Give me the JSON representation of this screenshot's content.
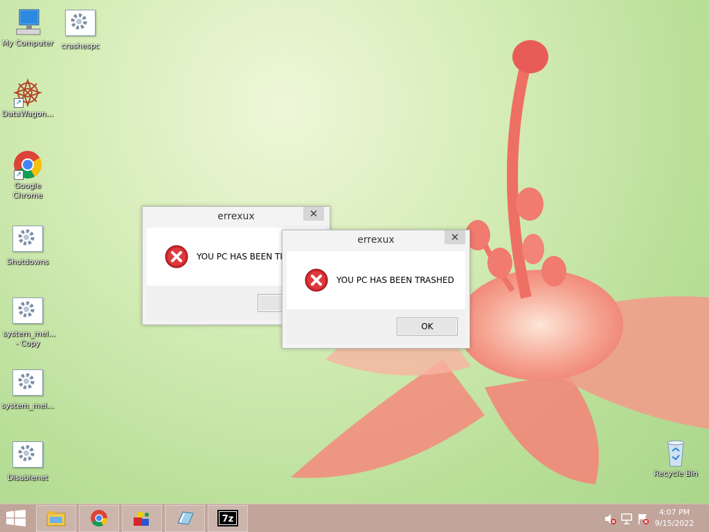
{
  "desktop": {
    "icons": [
      {
        "label": "My Computer",
        "icon": "computer-icon"
      },
      {
        "label": "crashespc",
        "icon": "gear-icon"
      },
      {
        "label": "DataWagon...",
        "icon": "datawagon-icon"
      },
      {
        "label": "Google Chrome",
        "icon": "chrome-icon"
      },
      {
        "label": "Shutdowns",
        "icon": "gear-icon"
      },
      {
        "label": "system_mel... - Copy",
        "icon": "gear-icon"
      },
      {
        "label": "system_mel...",
        "icon": "gear-icon"
      },
      {
        "label": "Disablenet",
        "icon": "gear-icon"
      },
      {
        "label": "Recycle Bin",
        "icon": "recycle-bin-icon"
      }
    ]
  },
  "dialogs": [
    {
      "title": "errexux",
      "message": "YOU PC HAS BEEN TRASHED",
      "button": "OK"
    },
    {
      "title": "errexux",
      "message": "YOU PC HAS BEEN TRASHED",
      "button": "OK"
    }
  ],
  "taskbar": {
    "pinned": [
      "file-explorer-icon",
      "chrome-icon",
      "app-cubes-icon",
      "notepad-icon",
      "7zip-icon"
    ],
    "tray_icons": [
      "volume-muted-icon",
      "network-icon",
      "action-center-icon"
    ],
    "clock": {
      "time": "4:07 PM",
      "date": "9/15/2022"
    }
  },
  "colors": {
    "taskbar": "#c1a59b",
    "error_red": "#c8242b"
  }
}
